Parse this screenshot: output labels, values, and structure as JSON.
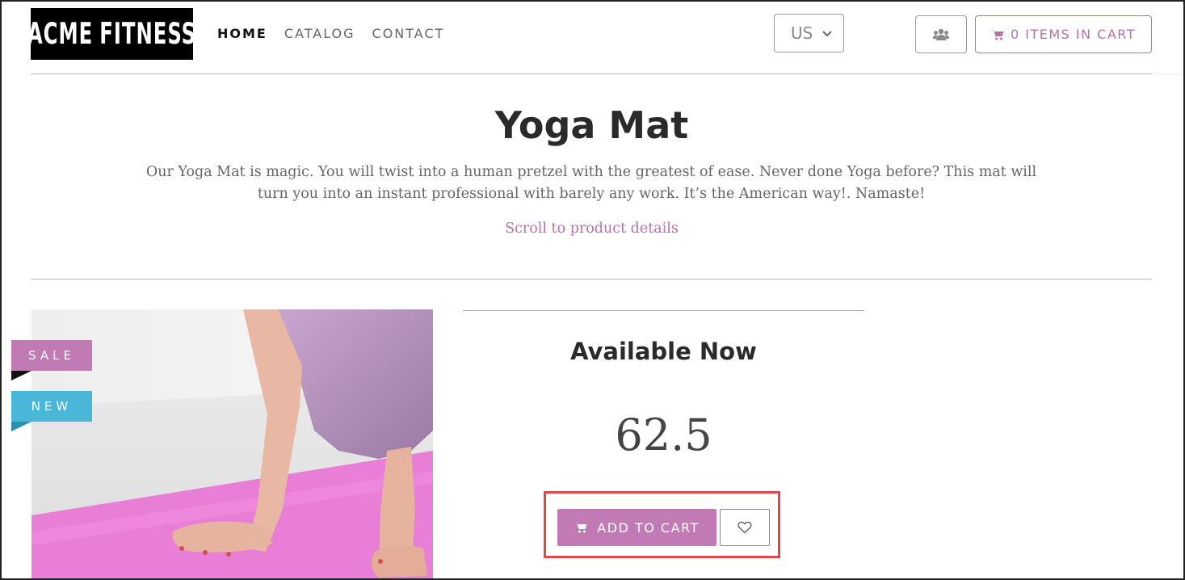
{
  "colors": {
    "accent": "#c27ab5",
    "accent_text": "#b772a9",
    "new_badge": "#4bb7d8",
    "highlight_box": "#e04848"
  },
  "logo": {
    "left_word": "ACME",
    "right_word": "FITNESS",
    "icon": "runner-icon"
  },
  "nav": {
    "items": [
      {
        "label": "HOME",
        "active": true
      },
      {
        "label": "CATALOG"
      },
      {
        "label": "CONTACT"
      }
    ]
  },
  "country_select": {
    "value": "US",
    "icon": "chevron-down-icon"
  },
  "users_button": {
    "icon": "users-icon"
  },
  "cart_button": {
    "label": "0 ITEMS IN CART",
    "icon": "shopping-cart-icon"
  },
  "product": {
    "title": "Yoga Mat",
    "description": "Our Yoga Mat is magic. You will twist into a human pretzel with the greatest of ease. Never done Yoga before? This mat will turn you into an instant professional with barely any work. It’s the American way!. Namaste!",
    "scroll_link": "Scroll to product details",
    "badges": {
      "sale": "SALE",
      "new": "NEW"
    },
    "availability": "Available Now",
    "price": "62.5",
    "add_to_cart": "ADD TO CART",
    "wishlist_icon": "heart-icon"
  }
}
